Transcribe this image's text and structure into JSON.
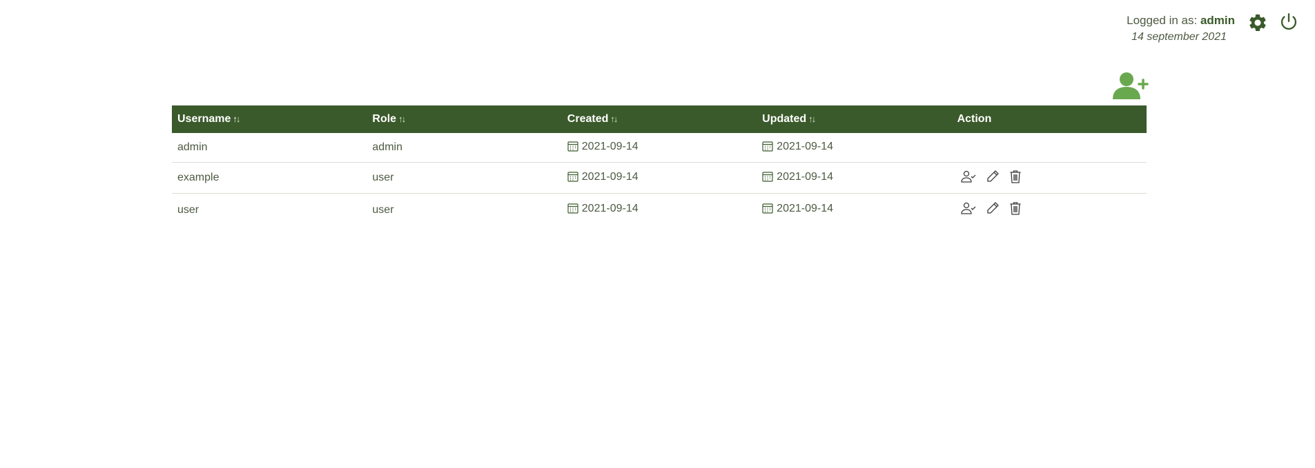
{
  "header": {
    "logged_in_label": "Logged in as: ",
    "username": "admin",
    "date": "14 september 2021",
    "settings_icon": "gear-icon",
    "logout_icon": "power-icon"
  },
  "add_user_icon": "add-user-icon",
  "colors": {
    "primary": "#3b5a2b",
    "accent": "#6aa84f",
    "text": "#4d5a42"
  },
  "table": {
    "columns": [
      {
        "label": "Username",
        "sortable": true
      },
      {
        "label": "Role",
        "sortable": true
      },
      {
        "label": "Created",
        "sortable": true
      },
      {
        "label": "Updated",
        "sortable": true
      },
      {
        "label": "Action",
        "sortable": false
      }
    ],
    "rows": [
      {
        "username": "admin",
        "role": "admin",
        "created": "2021-09-14",
        "updated": "2021-09-14",
        "actions": []
      },
      {
        "username": "example",
        "role": "user",
        "created": "2021-09-14",
        "updated": "2021-09-14",
        "actions": [
          "user-check-icon",
          "pencil-icon",
          "trash-icon"
        ]
      },
      {
        "username": "user",
        "role": "user",
        "created": "2021-09-14",
        "updated": "2021-09-14",
        "actions": [
          "user-check-icon",
          "pencil-icon",
          "trash-icon"
        ]
      }
    ]
  }
}
